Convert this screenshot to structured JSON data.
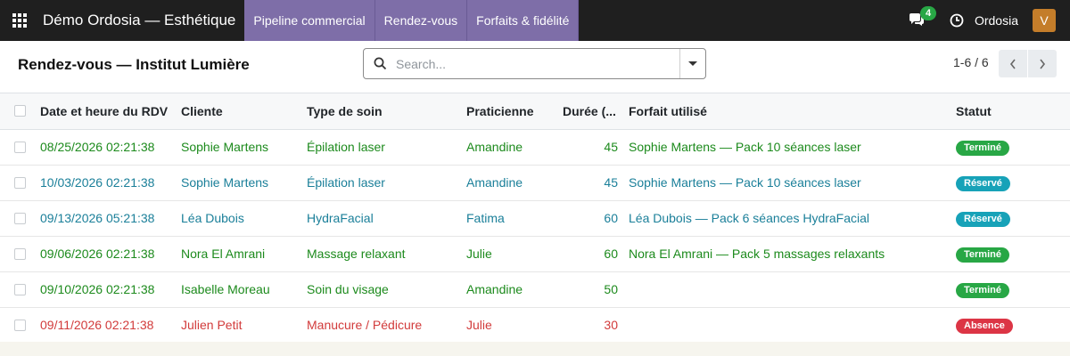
{
  "navbar": {
    "brand": "Démo Ordosia — Esthétique",
    "menu": [
      "Pipeline commercial",
      "Rendez-vous",
      "Forfaits & fidélité"
    ],
    "chat_count": "4",
    "company": "Ordosia",
    "avatar_letter": "V",
    "accent": "#7e6ea8"
  },
  "control": {
    "title": "Rendez-vous — Institut Lumière",
    "search_placeholder": "Search...",
    "pager": "1-6 / 6"
  },
  "table": {
    "columns": [
      "Date et heure du RDV",
      "Cliente",
      "Type de soin",
      "Praticienne",
      "Durée (...",
      "Forfait utilisé",
      "Statut"
    ],
    "rows": [
      {
        "date": "08/25/2026 02:21:38",
        "client": "Sophie Martens",
        "care": "Épilation laser",
        "practitioner": "Amandine",
        "duration": "45",
        "package": "Sophie Martens — Pack 10 séances laser",
        "status": "Terminé",
        "status_color": "#28a745",
        "row_class": "done"
      },
      {
        "date": "10/03/2026 02:21:38",
        "client": "Sophie Martens",
        "care": "Épilation laser",
        "practitioner": "Amandine",
        "duration": "45",
        "package": "Sophie Martens — Pack 10 séances laser",
        "status": "Réservé",
        "status_color": "#17a2b8",
        "row_class": "booked"
      },
      {
        "date": "09/13/2026 05:21:38",
        "client": "Léa Dubois",
        "care": "HydraFacial",
        "practitioner": "Fatima",
        "duration": "60",
        "package": "Léa Dubois — Pack 6 séances HydraFacial",
        "status": "Réservé",
        "status_color": "#17a2b8",
        "row_class": "booked"
      },
      {
        "date": "09/06/2026 02:21:38",
        "client": "Nora El Amrani",
        "care": "Massage relaxant",
        "practitioner": "Julie",
        "duration": "60",
        "package": "Nora El Amrani — Pack 5 massages relaxants",
        "status": "Terminé",
        "status_color": "#28a745",
        "row_class": "done"
      },
      {
        "date": "09/10/2026 02:21:38",
        "client": "Isabelle Moreau",
        "care": "Soin du visage",
        "practitioner": "Amandine",
        "duration": "50",
        "package": "",
        "status": "Terminé",
        "status_color": "#28a745",
        "row_class": "done"
      },
      {
        "date": "09/11/2026 02:21:38",
        "client": "Julien Petit",
        "care": "Manucure / Pédicure",
        "practitioner": "Julie",
        "duration": "30",
        "package": "",
        "status": "Absence",
        "status_color": "#dc3545",
        "row_class": "noshow"
      }
    ]
  }
}
